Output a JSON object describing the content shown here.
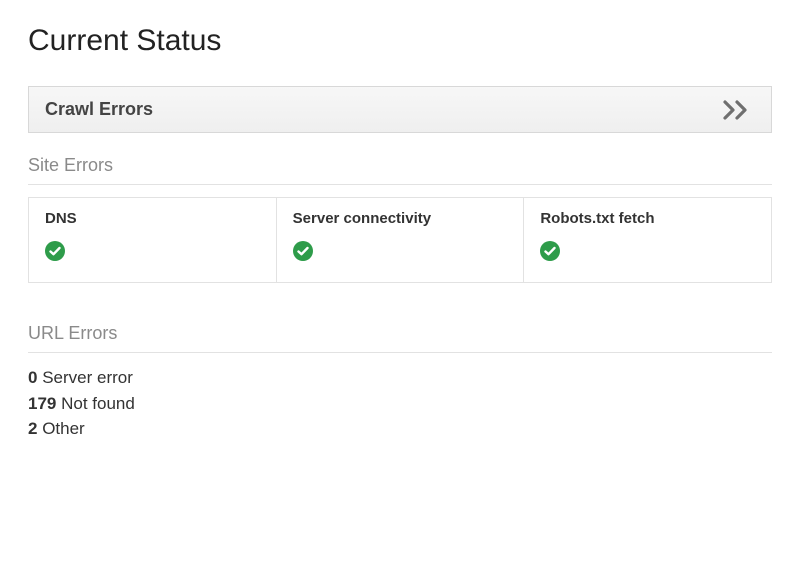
{
  "page": {
    "title": "Current Status"
  },
  "panel": {
    "title": "Crawl Errors"
  },
  "site_errors": {
    "label": "Site Errors",
    "cards": [
      {
        "title": "DNS",
        "status": "ok"
      },
      {
        "title": "Server connectivity",
        "status": "ok"
      },
      {
        "title": "Robots.txt fetch",
        "status": "ok"
      }
    ]
  },
  "url_errors": {
    "label": "URL Errors",
    "items": [
      {
        "count": "0",
        "label": "Server error"
      },
      {
        "count": "179",
        "label": "Not found"
      },
      {
        "count": "2",
        "label": "Other"
      }
    ]
  },
  "colors": {
    "ok_green": "#2e9c4a",
    "chevron_gray": "#6f6f6f"
  }
}
